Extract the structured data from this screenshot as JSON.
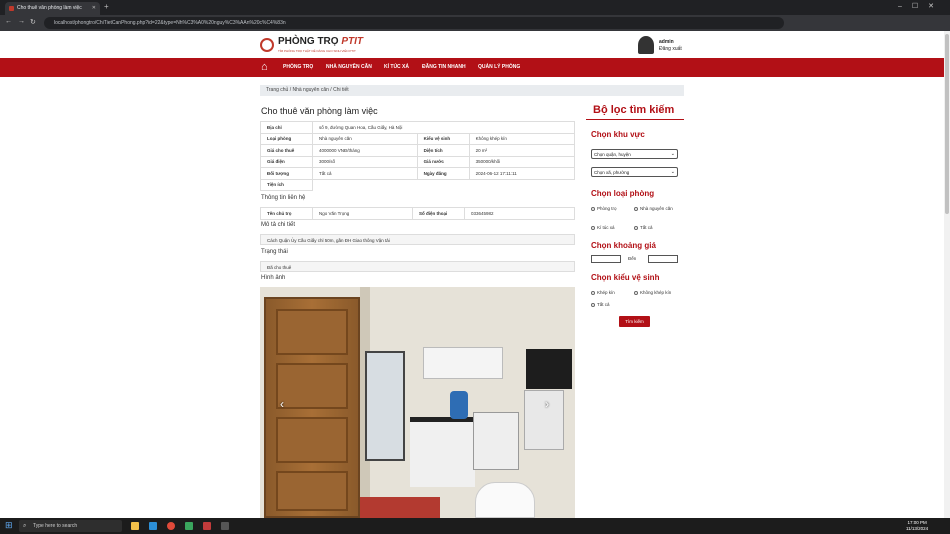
{
  "browser": {
    "tab_title": "Cho thuê văn phòng làm việc",
    "url": "localhost/phongtro/ChiTietCanPhong.php?id=22&type=Nh%C3%A0%20nguy%C3%AAn%20c%C4%83n"
  },
  "header": {
    "logo_title_main": "PHÒNG TRỌ ",
    "logo_title_accent": "PTIT",
    "logo_subtitle": "TÌM PHÒNG TRỌ THẬT DỄ DÀNG CHO SINH VIÊN PTIT",
    "user_name": "admin",
    "logout_label": "Đăng xuất"
  },
  "nav": {
    "items": [
      "PHÒNG TRỌ",
      "NHÀ NGUYÊN CĂN",
      "KÍ TÚC XÁ",
      "ĐĂNG TIN NHANH",
      "QUẢN LÝ PHÒNG"
    ]
  },
  "breadcrumb": "Trang chủ / Nhà nguyên căn / Chi tiết",
  "detail": {
    "title": "Cho thuê văn phòng làm việc",
    "rows": {
      "address_key": "Địa chỉ",
      "address_val": "số 9, đường Quan Hoa, Cầu Giấy, Hà Nội",
      "type_key": "Loại phòng",
      "type_val": "Nhà nguyên căn",
      "toilet_key": "Kiểu vệ sinh",
      "toilet_val": "Không khép kín",
      "price_key": "Giá cho thuê",
      "price_val": "4000000 VNĐ/tháng",
      "area_key": "Diện tích",
      "area_val": "20 m²",
      "elec_key": "Giá điện",
      "elec_val": "3000/số",
      "water_key": "Giá nước",
      "water_val": "350000/khối",
      "target_key": "Đối tượng",
      "target_val": "Tất cả",
      "date_key": "Ngày đăng",
      "date_val": "2024-06-12 17:11:11",
      "amenity_key": "Tiện ích"
    },
    "contact_heading": "Thông tin liên hệ",
    "owner_key": "Tên chủ trọ",
    "owner_val": "Ngo Văn Trọng",
    "phone_key": "Số điện thoại",
    "phone_val": "033645982",
    "desc_heading": "Mô tả chi tiết",
    "desc_text": "Cách Quận Ủy Cầu Giấy chỉ 50m, gần ĐH Giao thông Vận tải",
    "status_heading": "Trạng thái",
    "status_text": "Đã cho thuê",
    "images_heading": "Hình ảnh"
  },
  "filter": {
    "title": "Bộ lọc tìm kiếm",
    "area_heading": "Chọn khu vực",
    "district_select": "Chọn quận, huyện",
    "ward_select": "Chọn xã, phường",
    "roomtype_heading": "Chọn loại phòng",
    "roomtype_options": [
      "Phòng trọ",
      "Nhà nguyên căn",
      "Kí túc xá",
      "Tất cả"
    ],
    "price_heading": "Chọn khoảng giá",
    "price_to": "Đến",
    "toilet_heading": "Chọn kiểu vệ sinh",
    "toilet_options": [
      "Khép kín",
      "Không khép kín",
      "Tất cả"
    ],
    "search_button": "Tìm kiếm"
  },
  "taskbar": {
    "search_placeholder": "Type here to search",
    "time": "17:00 PM",
    "date": "11/13/2024"
  }
}
